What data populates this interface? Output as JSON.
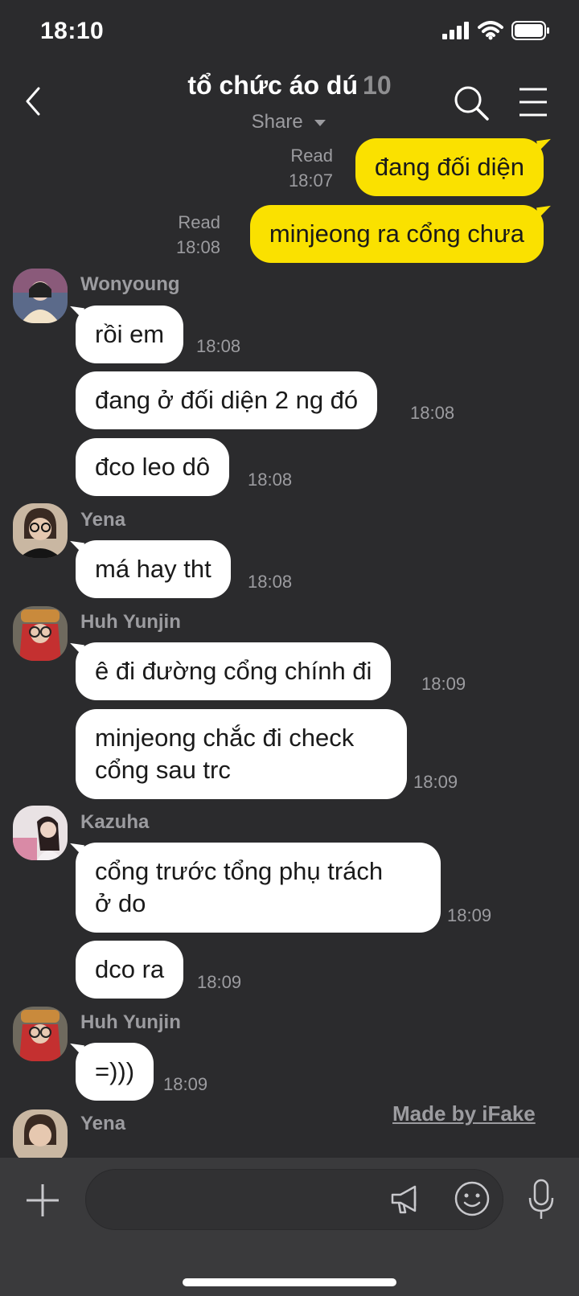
{
  "status": {
    "time": "18:10"
  },
  "header": {
    "title": "tổ chức áo dú",
    "member_count": "10",
    "subtitle": "Share"
  },
  "outgoing": [
    {
      "read": "Read",
      "time": "18:07",
      "text": "đang đối diện"
    },
    {
      "read": "Read",
      "time": "18:08",
      "text": "minjeong ra cổng chưa"
    }
  ],
  "groups": [
    {
      "sender": "Wonyoung",
      "messages": [
        {
          "text": "rồi em",
          "time": "18:08"
        },
        {
          "text": "đang ở đối diện 2 ng đó",
          "time": "18:08"
        },
        {
          "text": "đco leo dô",
          "time": "18:08"
        }
      ]
    },
    {
      "sender": "Yena",
      "messages": [
        {
          "text": "má hay tht",
          "time": "18:08"
        }
      ]
    },
    {
      "sender": "Huh Yunjin",
      "messages": [
        {
          "text": "ê đi đường cổng chính đi",
          "time": "18:09"
        },
        {
          "text": "minjeong chắc đi check\ncổng sau trc",
          "time": "18:09"
        }
      ]
    },
    {
      "sender": "Kazuha",
      "messages": [
        {
          "text": "cổng trước tổng phụ trách\nở do",
          "time": "18:09"
        },
        {
          "text": "dco ra",
          "time": "18:09"
        }
      ]
    },
    {
      "sender": "Huh Yunjin",
      "messages": [
        {
          "text": "=)))",
          "time": "18:09"
        }
      ]
    },
    {
      "sender": "Yena",
      "messages": []
    }
  ],
  "watermark": "Made by iFake",
  "colors": {
    "background": "#2b2b2d",
    "outgoing_bubble": "#fae100",
    "incoming_bubble": "#ffffff",
    "meta_text": "#9c9ca0"
  },
  "icons": [
    "back-icon",
    "search-icon",
    "menu-icon",
    "caret-down-icon",
    "plus-icon",
    "megaphone-icon",
    "emoji-icon",
    "microphone-icon",
    "signal-icon",
    "wifi-icon",
    "battery-icon"
  ]
}
